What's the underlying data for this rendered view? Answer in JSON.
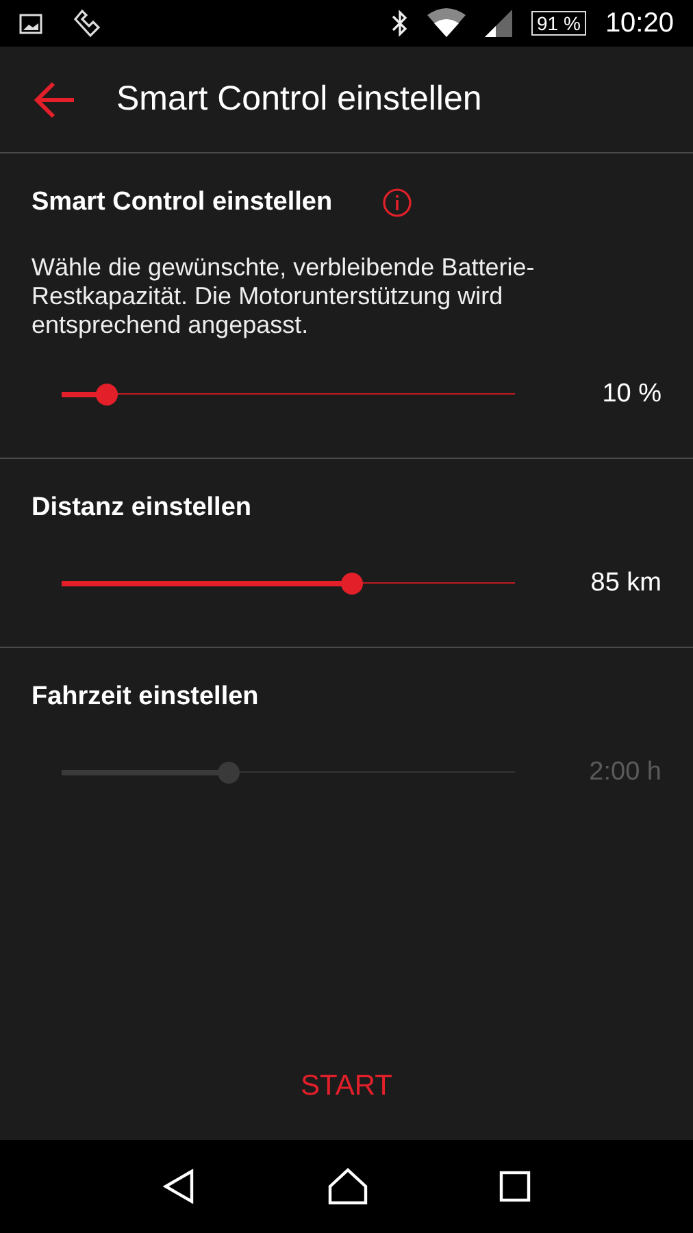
{
  "status_bar": {
    "battery": "91 %",
    "time": "10:20"
  },
  "toolbar": {
    "title": "Smart Control einstellen"
  },
  "sections": [
    {
      "title": "Smart Control einstellen",
      "info": true,
      "description": "Wähle die gewünschte, verbleibende Batterie-Restkapazität. Die Motorunterstützung wird entsprechend angepasst.",
      "level": 0.1,
      "reading": "10 %",
      "disabled": false
    },
    {
      "title": "Distanz einstellen",
      "info": false,
      "level": 0.64,
      "reading": "85 km",
      "disabled": false
    },
    {
      "title": "Fahrzeit einstellen",
      "info": false,
      "level": 0.37,
      "reading": "2:00 h",
      "disabled": true
    }
  ],
  "start_button": "START"
}
